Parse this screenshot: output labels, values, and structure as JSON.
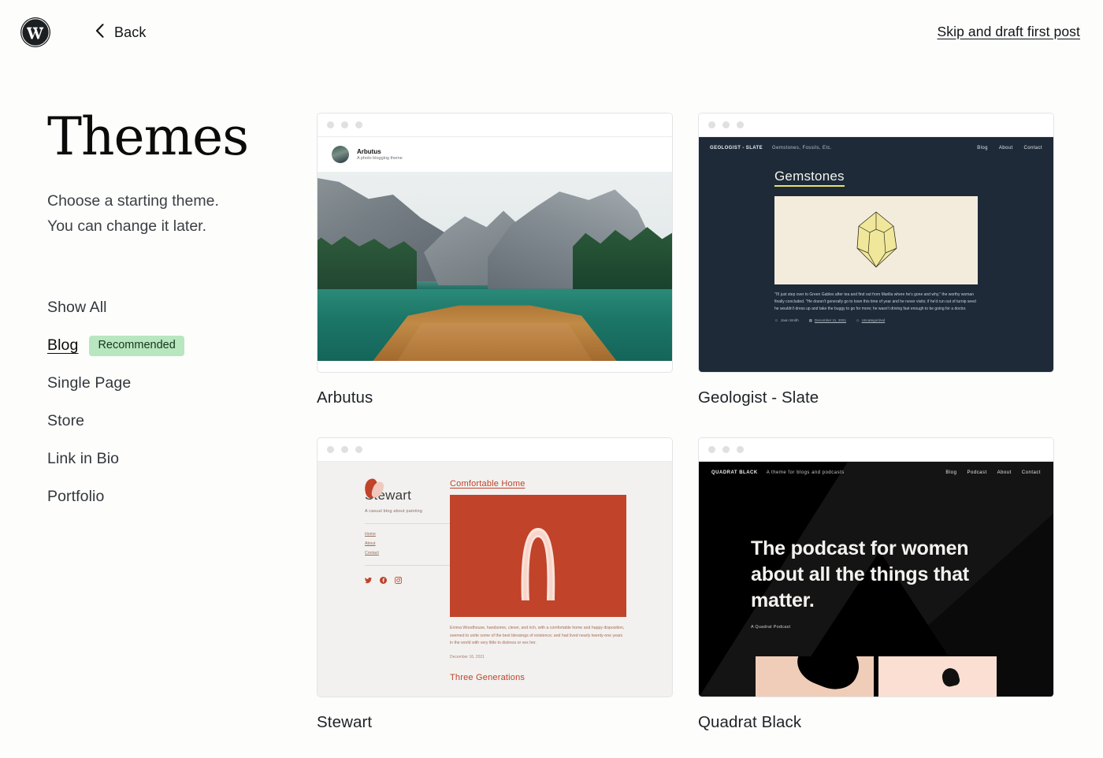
{
  "topbar": {
    "logo_icon": "wordpress-logo-icon",
    "back_icon": "chevron-left-icon",
    "back_label": "Back",
    "skip_label": "Skip and draft first post"
  },
  "sidebar": {
    "title": "Themes",
    "description_line1": "Choose a starting theme.",
    "description_line2": "You can change it later.",
    "filters": [
      {
        "label": "Show All",
        "active": false,
        "badge": ""
      },
      {
        "label": "Blog",
        "active": true,
        "badge": "Recommended"
      },
      {
        "label": "Single Page",
        "active": false,
        "badge": ""
      },
      {
        "label": "Store",
        "active": false,
        "badge": ""
      },
      {
        "label": "Link in Bio",
        "active": false,
        "badge": ""
      },
      {
        "label": "Portfolio",
        "active": false,
        "badge": ""
      }
    ],
    "badge_color": "#b8e6bf"
  },
  "themes": [
    {
      "name": "Arbutus",
      "preview": {
        "site_title": "Arbutus",
        "site_tagline": "A photo blogging theme",
        "avatar_icon": "avatar-icon",
        "hero_image": "mountain-lake-boat-photo"
      }
    },
    {
      "name": "Geologist - Slate",
      "preview": {
        "brand": "GEOLOGIST - SLATE",
        "tagline": "Gemstones, Fossils, Etc.",
        "nav": [
          "Blog",
          "About",
          "Contact"
        ],
        "post_title": "Gemstones",
        "figure_icon": "gemstone-illustration",
        "body": "\"I'll just step over to Green Gables after tea and find out from Marilla where he's gone and why,\" the worthy woman finally concluded. \"He doesn't generally go to town this time of year and he never visits; if he'd run out of turnip seed he wouldn't dress up and take the buggy to go for more; he wasn't driving fast enough to be going for a doctor.",
        "meta_author": "Joan Smith",
        "meta_date": "December 11, 2021",
        "meta_category": "Uncategorized",
        "bg_color": "#1e2a38",
        "accent_color": "#e9e06b"
      }
    },
    {
      "name": "Stewart",
      "preview": {
        "site_title": "Stewart",
        "site_tagline": "A casual blog about painting",
        "nav": [
          "Home",
          "About",
          "Contact"
        ],
        "social": [
          "twitter-icon",
          "facebook-icon",
          "instagram-icon"
        ],
        "post_title": "Comfortable Home",
        "figure_icon": "arch-brushstroke-painting",
        "body": "Emma Woodhouse, handsome, clever, and rich, with a comfortable home and happy disposition, seemed to unite some of the best blessings of existence; and had lived nearly twenty-one years in the world with very little to distress or vex her.",
        "post_date": "December 16, 2021",
        "next_post_title": "Three Generations",
        "accent_color": "#c0432a",
        "bg_color": "#f2f1ef"
      }
    },
    {
      "name": "Quadrat Black",
      "preview": {
        "brand": "QUADRAT BLACK",
        "tagline": "A theme for blogs and podcasts",
        "nav": [
          "Blog",
          "Podcast",
          "About",
          "Contact"
        ],
        "headline": "The podcast for women about all the things that matter.",
        "subline": "A Quadrat Podcast",
        "bg_color": "#141414"
      }
    }
  ]
}
